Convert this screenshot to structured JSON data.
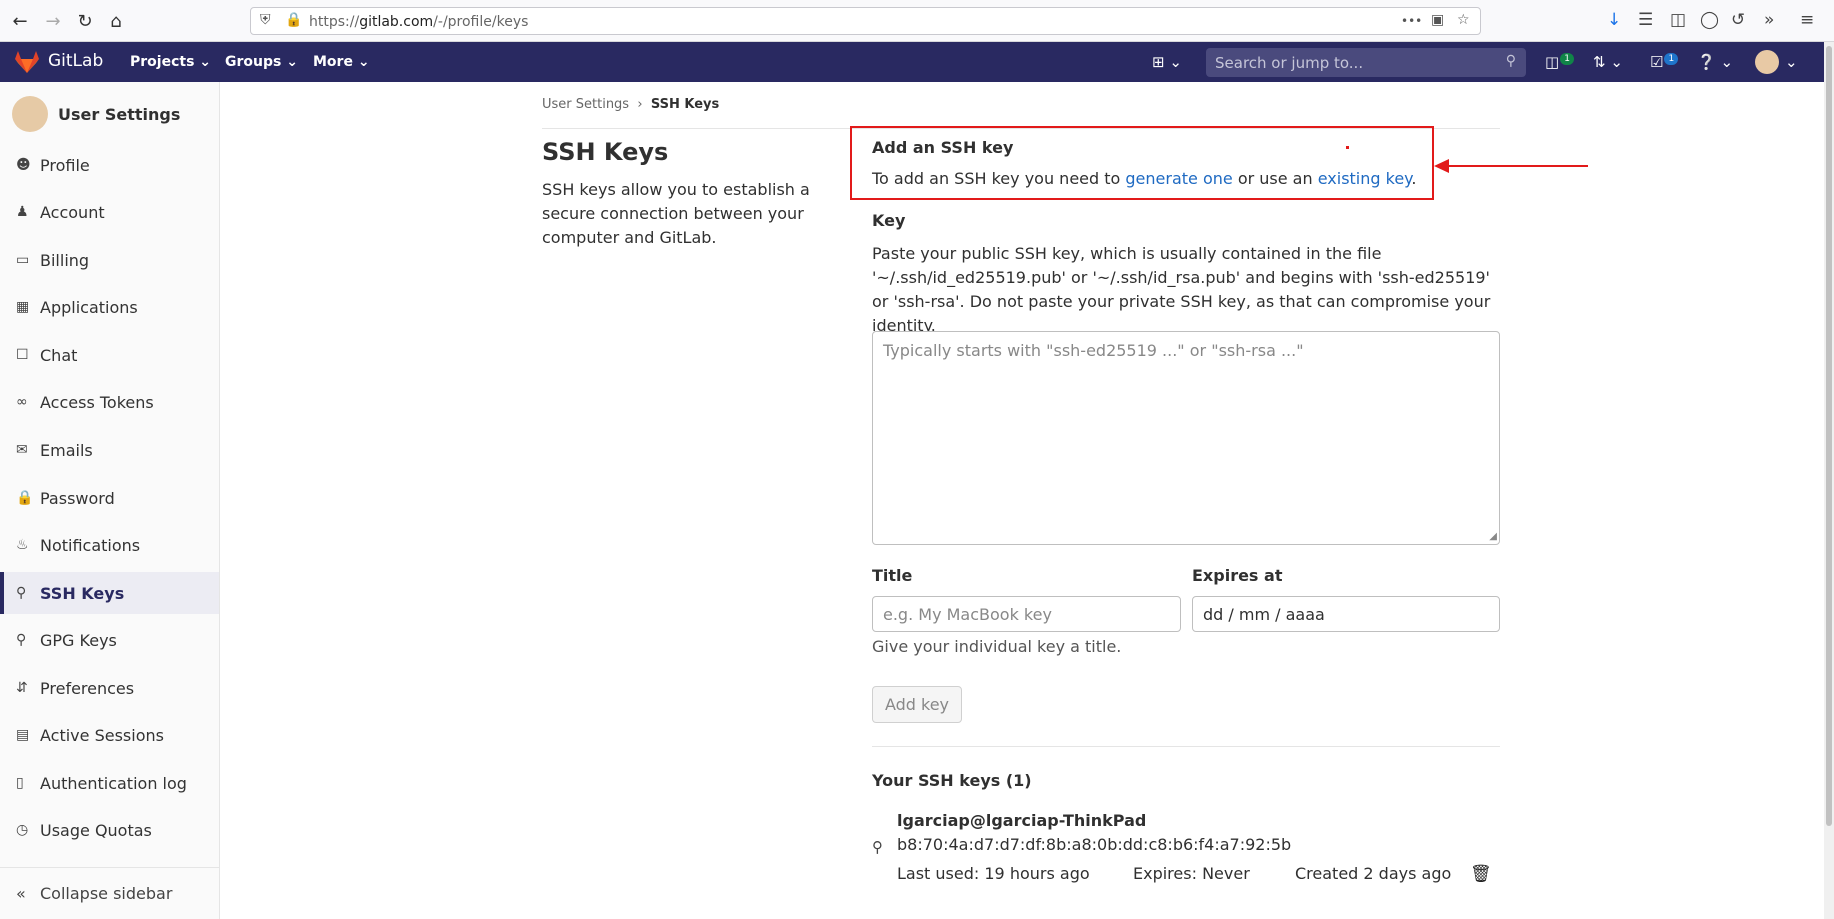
{
  "browser": {
    "url_prefix": "https://",
    "url_host": "gitlab.com",
    "url_path": "/-/profile/keys",
    "more_glyph": "•••"
  },
  "header": {
    "brand": "GitLab",
    "menus": [
      "Projects",
      "Groups",
      "More"
    ],
    "search_placeholder": "Search or jump to...",
    "issues_badge": "1",
    "todos_badge": "1"
  },
  "sidebar": {
    "title": "User Settings",
    "items": [
      {
        "label": "Profile",
        "icon": "profile-icon"
      },
      {
        "label": "Account",
        "icon": "account-icon"
      },
      {
        "label": "Billing",
        "icon": "billing-icon"
      },
      {
        "label": "Applications",
        "icon": "applications-icon"
      },
      {
        "label": "Chat",
        "icon": "chat-icon"
      },
      {
        "label": "Access Tokens",
        "icon": "token-icon"
      },
      {
        "label": "Emails",
        "icon": "email-icon"
      },
      {
        "label": "Password",
        "icon": "lock-icon"
      },
      {
        "label": "Notifications",
        "icon": "bell-icon"
      },
      {
        "label": "SSH Keys",
        "icon": "key-icon"
      },
      {
        "label": "GPG Keys",
        "icon": "key-icon"
      },
      {
        "label": "Preferences",
        "icon": "preferences-icon"
      },
      {
        "label": "Active Sessions",
        "icon": "monitor-icon"
      },
      {
        "label": "Authentication log",
        "icon": "log-icon"
      },
      {
        "label": "Usage Quotas",
        "icon": "quota-icon"
      }
    ],
    "active_item": "SSH Keys",
    "collapse_label": "Collapse sidebar"
  },
  "breadcrumb": {
    "parent": "User Settings",
    "separator": "›",
    "current": "SSH Keys"
  },
  "page": {
    "title": "SSH Keys",
    "description": "SSH keys allow you to establish a secure connection between your computer and GitLab."
  },
  "add_key": {
    "title": "Add an SSH key",
    "text_before": "To add an SSH key you need to ",
    "link1": "generate one",
    "text_middle": " or use an ",
    "link2": "existing key",
    "text_after": "."
  },
  "form": {
    "key_label": "Key",
    "key_help": "Paste your public SSH key, which is usually contained in the file '~/.ssh/id_ed25519.pub' or '~/.ssh/id_rsa.pub' and begins with 'ssh-ed25519' or 'ssh-rsa'. Do not paste your private SSH key, as that can compromise your identity.",
    "key_placeholder": "Typically starts with \"ssh-ed25519 ...\" or \"ssh-rsa ...\"",
    "title_label": "Title",
    "title_placeholder": "e.g. My MacBook key",
    "expires_label": "Expires at",
    "expires_value": "dd / mm / aaaa",
    "title_hint": "Give your individual key a title.",
    "add_button": "Add key"
  },
  "your_keys": {
    "heading": "Your SSH keys (1)",
    "keys": [
      {
        "name": "lgarciap@lgarciap-ThinkPad",
        "fingerprint": "b8:70:4a:d7:d7:df:8b:a8:0b:dd:c8:b6:f4:a7:92:5b",
        "last_used": "Last used: 19 hours ago",
        "expires": "Expires: Never",
        "created": "Created 2 days ago"
      }
    ]
  },
  "colors": {
    "header_bg": "#292961",
    "link": "#1f6ac2",
    "annotation": "#e21a1a"
  }
}
